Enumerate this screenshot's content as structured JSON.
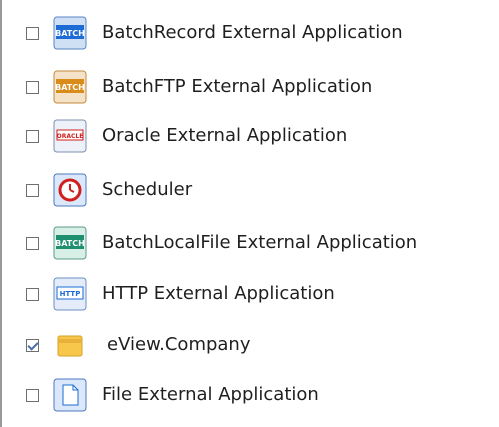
{
  "items": [
    {
      "label": "BatchRecord External Application",
      "checked": false,
      "icon": "batch-icon"
    },
    {
      "label": "BatchFTP External Application",
      "checked": false,
      "icon": "batch-ftp-icon"
    },
    {
      "label": "Oracle External Application",
      "checked": false,
      "icon": "oracle-icon"
    },
    {
      "label": "Scheduler",
      "checked": false,
      "icon": "scheduler-icon"
    },
    {
      "label": "BatchLocalFile External Application",
      "checked": false,
      "icon": "batch-localfile-icon"
    },
    {
      "label": "HTTP External Application",
      "checked": false,
      "icon": "http-icon"
    },
    {
      "label": "eView.Company",
      "checked": true,
      "icon": "folder-icon"
    },
    {
      "label": "File External Application",
      "checked": false,
      "icon": "file-icon"
    }
  ],
  "colors": {
    "border": "#9a9a9a",
    "icon_blue": "#1e6bd6",
    "icon_orange": "#d98c1a",
    "icon_red": "#cf1f1f",
    "folder_yellow": "#f6c74a"
  }
}
